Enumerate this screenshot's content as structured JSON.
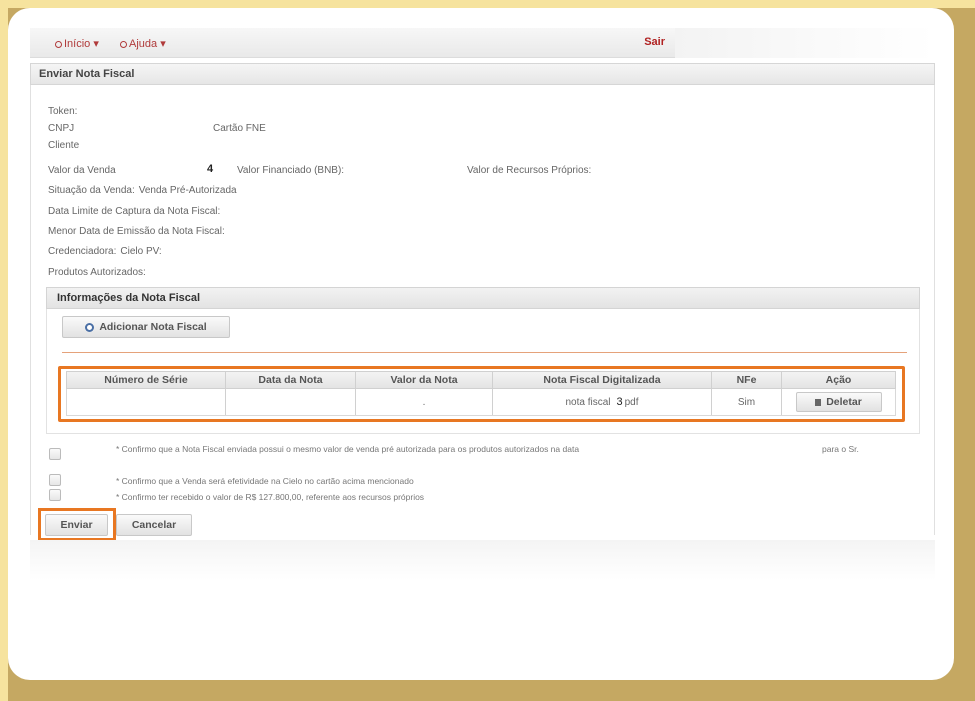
{
  "menu": {
    "inicio": "Início",
    "ajuda": "Ajuda",
    "sair": "Sair"
  },
  "panel": {
    "title": "Enviar Nota Fiscal"
  },
  "fields": {
    "token": "Token:",
    "cnpj": "CNPJ",
    "cartao_fne": "Cartão FNE",
    "cliente": "Cliente",
    "valor_venda": "Valor da Venda",
    "valor_venda_digit": "4",
    "valor_financiado": "Valor Financiado (BNB):",
    "valor_recursos": "Valor de Recursos Próprios:",
    "situacao_label": "Situação da Venda:",
    "situacao_value": "Venda Pré-Autorizada",
    "data_limite": "Data Limite de Captura da Nota Fiscal:",
    "menor_data": "Menor Data de Emissão da Nota Fiscal:",
    "credenciadora_label": "Credenciadora:",
    "credenciadora_value": "Cielo  PV:",
    "produtos": "Produtos Autorizados:"
  },
  "nota_fiscal": {
    "title": "Informações da Nota Fiscal",
    "add_button": "Adicionar Nota Fiscal",
    "columns": [
      "Número de Série",
      "Data da Nota",
      "Valor da Nota",
      "Nota Fiscal Digitalizada",
      "NFe",
      "Ação"
    ],
    "row": {
      "numero_serie": "",
      "data_nota": "",
      "valor_nota": ".",
      "nota_prefix": "nota fiscal",
      "nota_digit": "3",
      "nota_suffix": "pdf",
      "nfe": "Sim",
      "acao": "Deletar"
    }
  },
  "confirmations": [
    "* Confirmo que a Nota Fiscal enviada possui o mesmo valor de venda pré autorizada para os produtos autorizados na data",
    "para o Sr.",
    "* Confirmo que a Venda será efetividade na Cielo no cartão acima mencionado",
    "* Confirmo ter recebido o valor de R$ 127.800,00, referente aos recursos próprios"
  ],
  "actions": {
    "enviar": "Enviar",
    "cancelar": "Cancelar"
  },
  "colors": {
    "highlight": "#e87722",
    "background": "#c5a862",
    "link": "#b03a3a"
  }
}
